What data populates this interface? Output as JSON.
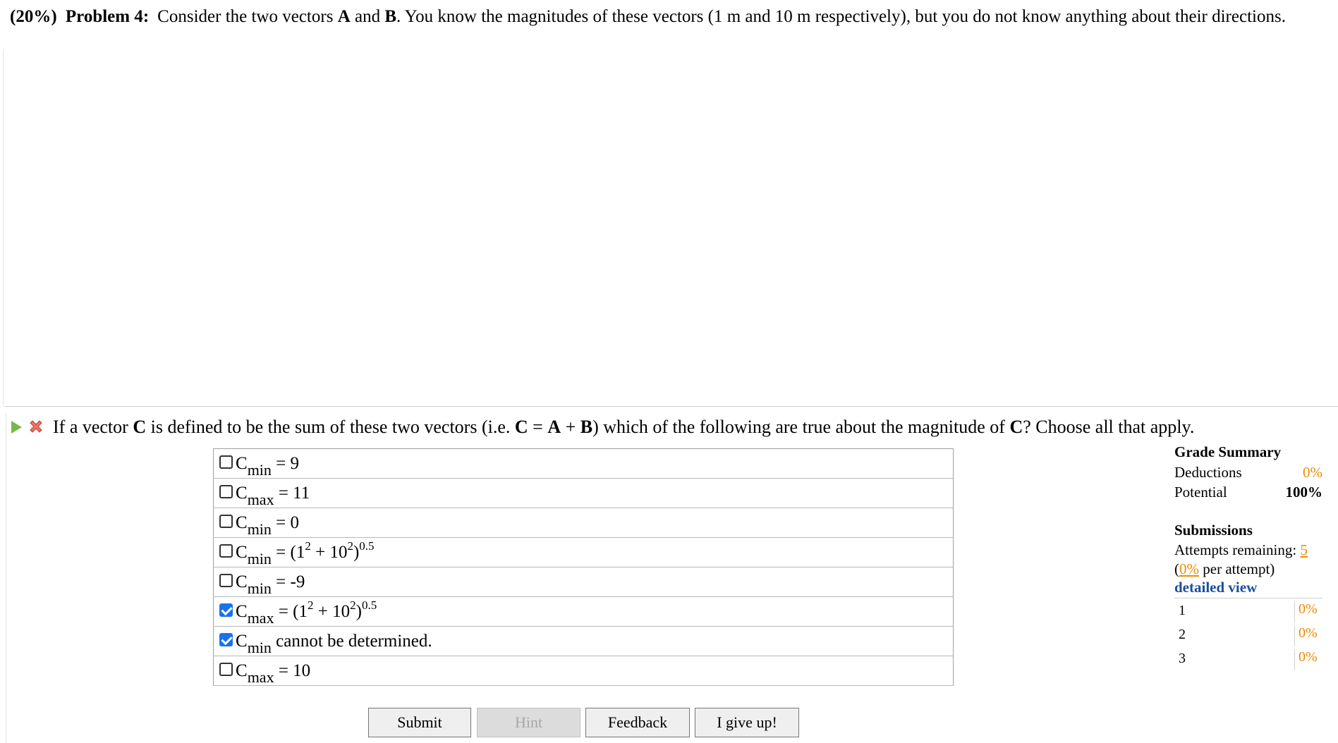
{
  "problem": {
    "weight": "(20%)",
    "label": "Problem 4:",
    "text_a": "Consider the two vectors ",
    "vec_a": "A",
    "text_b": " and ",
    "vec_b": "B",
    "text_c": ". You know the magnitudes of these vectors (1 m and 10 m respectively), but you do not know anything about their directions."
  },
  "question": {
    "t1": "If a vector ",
    "c": "C",
    "t2": " is defined to be the sum of these two vectors (i.e. ",
    "eq_c": "C",
    "eq1": " = ",
    "eq_a": "A",
    "eq2": " + ",
    "eq_b": "B",
    "t3": ") which of the following are true about the magnitude of ",
    "c2": "C",
    "t4": "? Choose all that apply."
  },
  "choices": [
    {
      "checked": false,
      "sym": "C",
      "sub": "min",
      "pre": " = 9",
      "sup1": "",
      "mid": "",
      "sup2": "",
      "end": "",
      "after": ""
    },
    {
      "checked": false,
      "sym": "C",
      "sub": "max",
      "pre": " = 11",
      "sup1": "",
      "mid": "",
      "sup2": "",
      "end": "",
      "after": ""
    },
    {
      "checked": false,
      "sym": "C",
      "sub": "min",
      "pre": " = 0",
      "sup1": "",
      "mid": "",
      "sup2": "",
      "end": "",
      "after": ""
    },
    {
      "checked": false,
      "sym": "C",
      "sub": "min",
      "pre": " = (1",
      "sup1": "2",
      "mid": " + 10",
      "sup2": "2",
      "end": ")",
      "after": "0.5"
    },
    {
      "checked": false,
      "sym": "C",
      "sub": "min",
      "pre": " = -9",
      "sup1": "",
      "mid": "",
      "sup2": "",
      "end": "",
      "after": ""
    },
    {
      "checked": true,
      "sym": "C",
      "sub": "max",
      "pre": " = (1",
      "sup1": "2",
      "mid": " + 10",
      "sup2": "2",
      "end": ")",
      "after": "0.5"
    },
    {
      "checked": true,
      "sym": "C",
      "sub": "min",
      "pre": " cannot be determined.",
      "sup1": "",
      "mid": "",
      "sup2": "",
      "end": "",
      "after": ""
    },
    {
      "checked": false,
      "sym": "C",
      "sub": "max",
      "pre": " = 10",
      "sup1": "",
      "mid": "",
      "sup2": "",
      "end": "",
      "after": ""
    }
  ],
  "buttons": {
    "submit": "Submit",
    "hint": "Hint",
    "feedback": "Feedback",
    "give_up": "I give up!"
  },
  "grade_summary": {
    "title": "Grade Summary",
    "deductions_label": "Deductions",
    "deductions_value": "0%",
    "potential_label": "Potential",
    "potential_value": "100%"
  },
  "submissions": {
    "title": "Submissions",
    "attempts_label": "Attempts remaining: ",
    "attempts_value": "5",
    "per_open": "(",
    "per_value": "0%",
    "per_close": " per attempt)",
    "detailed": "detailed view",
    "rows": [
      {
        "n": "1",
        "pct": "0%"
      },
      {
        "n": "2",
        "pct": "0%"
      },
      {
        "n": "3",
        "pct": "0%"
      }
    ]
  },
  "colors": {
    "accent_orange": "#f08a00",
    "link_blue": "#1a4f9c",
    "play_green": "#77b84a",
    "error_red": "#d9534f"
  }
}
